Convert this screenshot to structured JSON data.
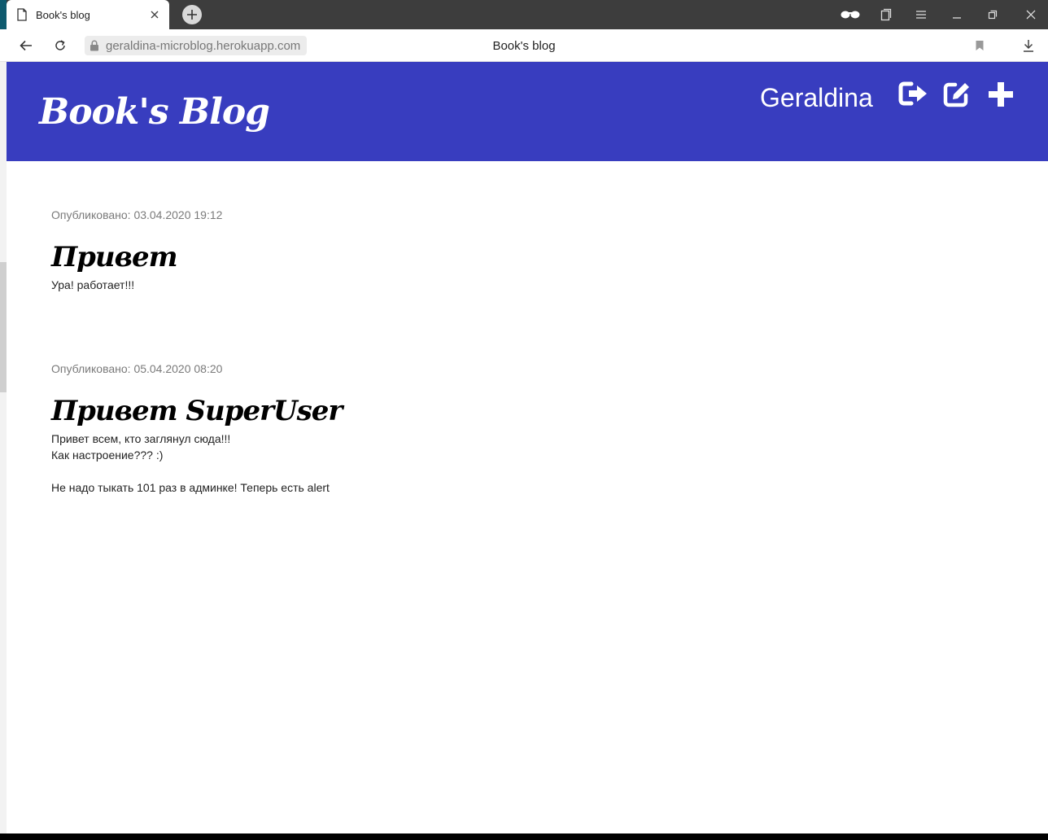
{
  "browser": {
    "tab_title": "Book's blog",
    "url": "geraldina-microblog.herokuapp.com",
    "page_title": "Book's blog"
  },
  "site": {
    "logo": "Book's Blog",
    "username": "Geraldina",
    "header_color": "#383dbf",
    "icons": [
      "logout-icon",
      "edit-icon",
      "plus-icon"
    ]
  },
  "posts": [
    {
      "date": "Опубликовано: 03.04.2020 19:12",
      "title": "Привет",
      "body": "Ура! работает!!!"
    },
    {
      "date": "Опубликовано: 05.04.2020 08:20",
      "title": "Привет SuperUser",
      "body": "Привет всем, кто заглянул сюда!!!\nКак настроение??? :)\n\nНе надо тыкать 101 раз в админке! Теперь есть alert"
    }
  ]
}
